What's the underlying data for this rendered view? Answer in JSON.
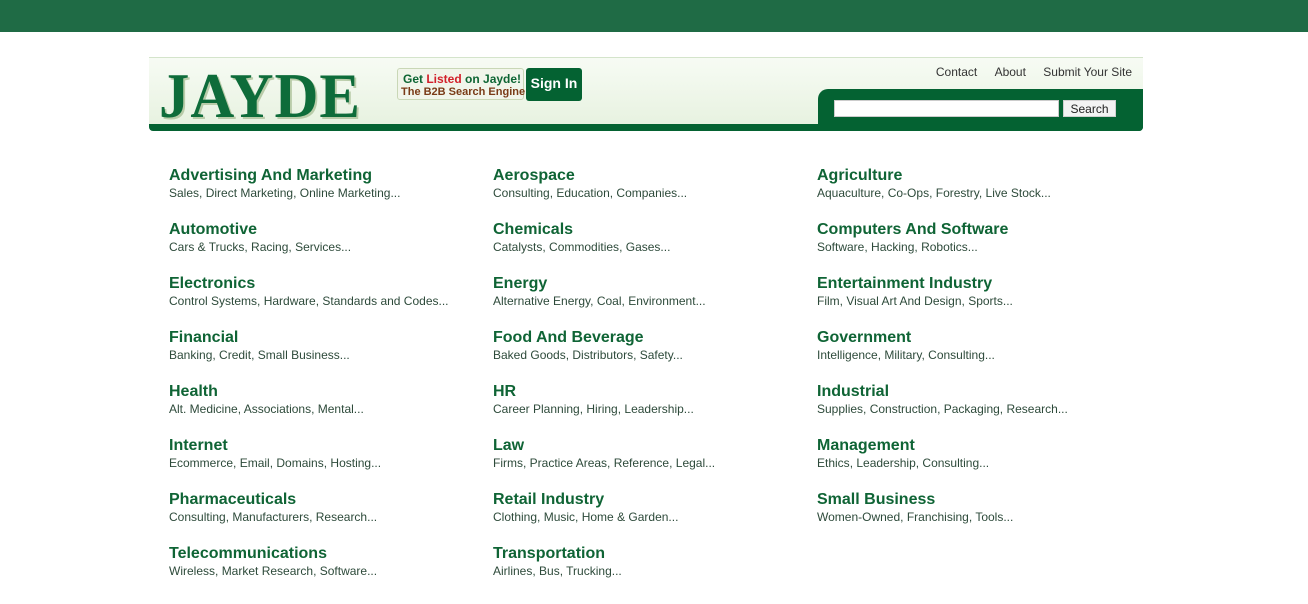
{
  "header": {
    "logo": "JAYDE",
    "promo": {
      "line1_a": "Get ",
      "line1_highlight": "Listed",
      "line1_b": " on Jayde!",
      "line2": "The B2B Search Engine"
    },
    "signin": "Sign In",
    "links": [
      "Contact",
      "About",
      "Submit Your Site"
    ],
    "search": {
      "value": "",
      "placeholder": "",
      "button": "Search"
    }
  },
  "colors": {
    "brand_green": "#046232",
    "top_bar": "#1f6b45",
    "highlight_red": "#d2202a"
  },
  "categories": [
    {
      "title": "Advertising And Marketing",
      "subs": [
        "Sales",
        "Direct Marketing",
        "Online Marketing..."
      ]
    },
    {
      "title": "Aerospace",
      "subs": [
        "Consulting",
        "Education",
        "Companies..."
      ]
    },
    {
      "title": "Agriculture",
      "subs": [
        "Aquaculture",
        "Co-Ops",
        "Forestry",
        "Live Stock..."
      ]
    },
    {
      "title": "Automotive",
      "subs": [
        "Cars & Trucks",
        "Racing",
        "Services..."
      ]
    },
    {
      "title": "Chemicals",
      "subs": [
        "Catalysts",
        "Commodities",
        "Gases..."
      ]
    },
    {
      "title": "Computers And Software",
      "subs": [
        "Software",
        "Hacking",
        "Robotics..."
      ]
    },
    {
      "title": "Electronics",
      "subs": [
        "Control Systems",
        "Hardware",
        "Standards and Codes..."
      ]
    },
    {
      "title": "Energy",
      "subs": [
        "Alternative Energy",
        "Coal",
        "Environment..."
      ]
    },
    {
      "title": "Entertainment Industry",
      "subs": [
        "Film",
        "Visual Art And Design",
        "Sports..."
      ]
    },
    {
      "title": "Financial",
      "subs": [
        "Banking",
        "Credit",
        "Small Business..."
      ]
    },
    {
      "title": "Food And Beverage",
      "subs": [
        "Baked Goods",
        "Distributors",
        "Safety..."
      ]
    },
    {
      "title": "Government",
      "subs": [
        "Intelligence",
        "Military",
        "Consulting..."
      ]
    },
    {
      "title": "Health",
      "subs": [
        "Alt. Medicine",
        "Associations",
        "Mental..."
      ]
    },
    {
      "title": "HR",
      "subs": [
        "Career Planning",
        "Hiring",
        "Leadership..."
      ]
    },
    {
      "title": "Industrial",
      "subs": [
        "Supplies",
        "Construction",
        "Packaging",
        "Research..."
      ]
    },
    {
      "title": "Internet",
      "subs": [
        "Ecommerce",
        "Email",
        "Domains",
        "Hosting..."
      ]
    },
    {
      "title": "Law",
      "subs": [
        "Firms",
        "Practice Areas",
        "Reference",
        "Legal..."
      ]
    },
    {
      "title": "Management",
      "subs": [
        "Ethics",
        "Leadership",
        "Consulting..."
      ]
    },
    {
      "title": "Pharmaceuticals",
      "subs": [
        "Consulting",
        "Manufacturers",
        "Research..."
      ]
    },
    {
      "title": "Retail Industry",
      "subs": [
        "Clothing",
        "Music",
        "Home & Garden..."
      ]
    },
    {
      "title": "Small Business",
      "subs": [
        "Women-Owned",
        "Franchising",
        "Tools..."
      ]
    },
    {
      "title": "Telecommunications",
      "subs": [
        "Wireless",
        "Market Research",
        "Software..."
      ]
    },
    {
      "title": "Transportation",
      "subs": [
        "Airlines",
        "Bus",
        "Trucking..."
      ]
    }
  ]
}
